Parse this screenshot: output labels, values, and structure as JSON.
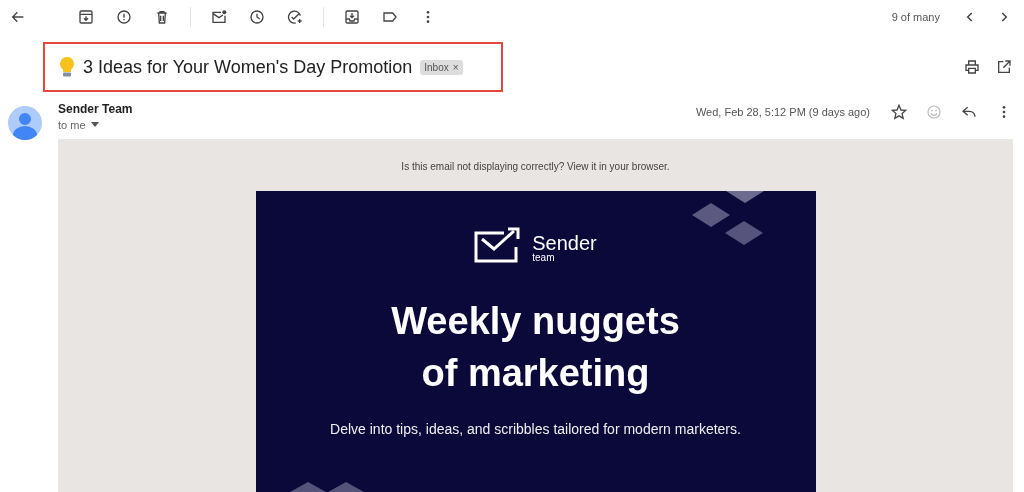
{
  "toolbar": {
    "position": "9 of many"
  },
  "subject": {
    "title": "3 Ideas for Your Women's Day Promotion",
    "label": "Inbox",
    "label_remove": "×",
    "highlighted": true
  },
  "message": {
    "sender": "Sender Team",
    "recipient": "to me",
    "date": "Wed, Feb 28, 5:12 PM (9 days ago)",
    "starred": false
  },
  "email": {
    "view_notice": "Is this email not displaying correctly? View it in your browser.",
    "logo_name": "Sender",
    "logo_sub": "team",
    "headline_lines": [
      "Weekly nuggets",
      "of marketing"
    ],
    "tagline": "Delve into tips, ideas, and scribbles tailored for modern marketers."
  }
}
